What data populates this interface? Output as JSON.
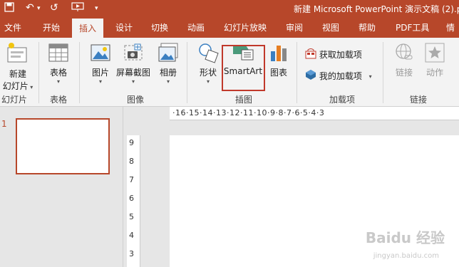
{
  "title_bar": {
    "title": "新建 Microsoft PowerPoint 演示文稿 (2).p"
  },
  "quick_access": {
    "undo_glyph": "↶",
    "redo_glyph": "↺",
    "dropdown_glyph": "▾"
  },
  "tabs": [
    {
      "label": "文件"
    },
    {
      "label": "开始"
    },
    {
      "label": "插入"
    },
    {
      "label": "设计"
    },
    {
      "label": "切换"
    },
    {
      "label": "动画"
    },
    {
      "label": "幻灯片放映"
    },
    {
      "label": "审阅"
    },
    {
      "label": "视图"
    },
    {
      "label": "帮助"
    },
    {
      "label": "PDF工具"
    },
    {
      "label": "情"
    }
  ],
  "ribbon": {
    "new_slide": {
      "line1": "新建",
      "line2": "幻灯片"
    },
    "table": {
      "label": "表格"
    },
    "picture": {
      "label": "图片"
    },
    "screenshot": {
      "label": "屏幕截图"
    },
    "album": {
      "label": "相册"
    },
    "shapes": {
      "label": "形状"
    },
    "smartart": {
      "label": "SmartArt"
    },
    "chart": {
      "label": "图表"
    },
    "get_addins": {
      "label": "获取加载项"
    },
    "my_addins": {
      "label": "我的加载项"
    },
    "link": {
      "label": "链接"
    },
    "action": {
      "label": "动作"
    },
    "groups": {
      "slides": "幻灯片",
      "tables": "表格",
      "images": "图像",
      "illustrations": "插图",
      "addins": "加载项",
      "links": "链接"
    }
  },
  "thumbnails": {
    "slide_number": "1"
  },
  "hruler": "·16·15·14·13·12·11·10·9·8·7·6·5·4·3",
  "vruler": [
    "9",
    "8",
    "7",
    "6",
    "5",
    "4",
    "3"
  ],
  "watermark": {
    "text": "Baidu 经验",
    "sub": "jingyan.baidu.com"
  },
  "colors": {
    "accent": "#b7472a",
    "highlight": "#c0392b"
  }
}
